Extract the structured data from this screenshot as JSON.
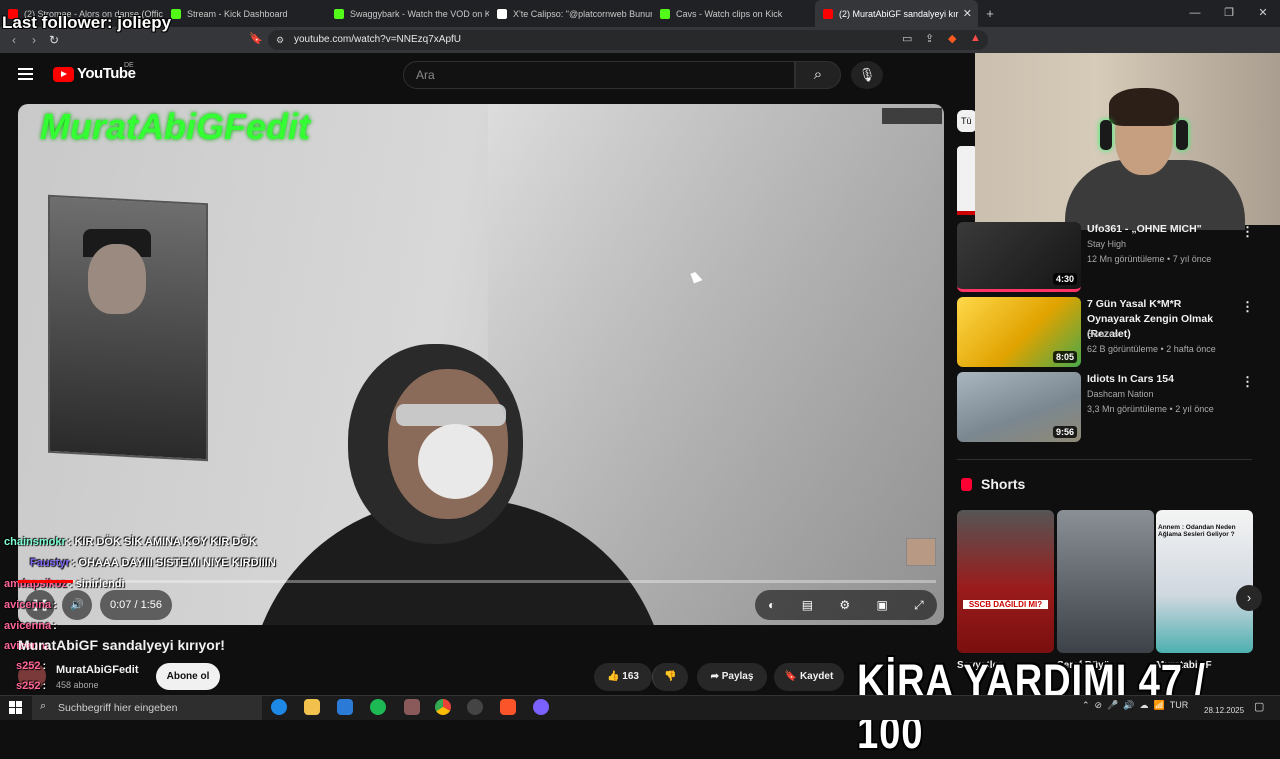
{
  "browser": {
    "tabs": [
      {
        "label": "(2) Stromae - Alors on danse (Official",
        "favicon_color": "#ff0000"
      },
      {
        "label": "Stream - Kick Dashboard",
        "favicon_color": "#53fc18"
      },
      {
        "label": "Swaggybark - Watch the VOD on Kick",
        "favicon_color": "#53fc18"
      },
      {
        "label": "X'te Calipso: \"@platcornweb Bunun i",
        "favicon_color": "#ffffff"
      },
      {
        "label": "Cavs - Watch clips on Kick",
        "favicon_color": "#53fc18"
      },
      {
        "label": "(2) MuratAbiGF sandalyeyi kır",
        "favicon_color": "#ff0000",
        "active": true
      }
    ],
    "url": "youtube.com/watch?v=NNEzq7xApfU"
  },
  "overlay": {
    "follower": "Last follower: joliepy",
    "kira_yardimi": "KİRA YARDIMI 47 / 100"
  },
  "youtube": {
    "logo_text": "YouTube",
    "country": "DE",
    "search_placeholder": "Ara"
  },
  "video": {
    "watermark": "MuratAbiGFedit",
    "time": "0:07 / 1:56",
    "progress": 0.06,
    "title": "MuratAbiGF sandalyeyi kırıyor!",
    "channel": "MuratAbiGFedit",
    "subscribers": "458 abone",
    "subscribe_label": "Abone ol",
    "likes": "163",
    "share_label": "Paylaş",
    "save_label": "Kaydet"
  },
  "chat": [
    {
      "name": "chainsmokr",
      "text": ": KIR DÖK SİK AMINA KOY KIR DÖK",
      "color": "#7fffd4"
    },
    {
      "name": "Faustyr",
      "text": ": OHAAA DAYIII SISTEMI NIYE KIRDIIIN",
      "color": "#7b68ee"
    },
    {
      "name": "amdapsikoz",
      "text": ": sinirlendi",
      "color": "#ff6699"
    },
    {
      "name": "avicenna",
      "text": ":",
      "color": "#ff6699"
    },
    {
      "name": "avicenna",
      "text": ":",
      "color": "#ff6699"
    },
    {
      "name": "avicenna",
      "text": "",
      "color": "#ff6699"
    },
    {
      "name": "s252",
      "text": ":",
      "color": "#ff6699"
    },
    {
      "name": "s252",
      "text": ":",
      "color": "#ff6699"
    }
  ],
  "recommendations": [
    {
      "title": "Ufo361 - „OHNE MICH\"",
      "channel": "Stay High",
      "meta": "12 Mn görüntüleme • 7 yıl önce",
      "duration": "4:30",
      "color": "#2a2a2a"
    },
    {
      "title": "7 Gün Yasal K*M*R Oynayarak Zengin Olmak (Rezalet)",
      "channel": "Swazes",
      "meta": "62 B görüntüleme • 2 hafta önce",
      "duration": "8:05",
      "color": "#e6b422"
    },
    {
      "title": "Idiots In Cars 154",
      "channel": "Dashcam Nation",
      "meta": "3,3 Mn görüntüleme • 2 yıl önce",
      "duration": "9:56",
      "color": "#7d8a94"
    }
  ],
  "shorts": {
    "heading": "Shorts",
    "items": [
      {
        "title": "Sovyetler",
        "color": "#9b1b1b",
        "caption": "SSCB DAĞILDI MI?"
      },
      {
        "title": "Şeref Büyü",
        "color": "#5e6670",
        "caption": ""
      },
      {
        "title": "MuratabiGF",
        "color": "#e8e8e8",
        "caption": "Annem : Odandan Neden Ağlama Sesleri Geliyor ?"
      }
    ]
  },
  "taskbar": {
    "search_placeholder": "Suchbegriff hier eingeben",
    "lang": "TUR",
    "date": "28.12.2025"
  },
  "chip_label": "Tü"
}
